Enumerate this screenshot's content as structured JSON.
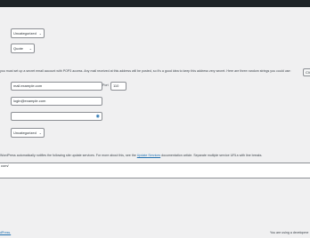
{
  "selects": {
    "category_top": "Uncategorized",
    "format": "Quote",
    "category_bottom": "Uncategorized"
  },
  "mail": {
    "description": "you must set up a secret email account with POP3 access. Any mail received at this address will be posted, so it's a good idea to keep this address very secret. Here are three random strings you could use:",
    "button_label": "Cli",
    "server_value": "mail.example.com",
    "port_label": "Port",
    "port_value": "110",
    "login_value": "login@example.com",
    "password_value": ""
  },
  "update_services": {
    "description_pre": "WordPress automatically notifies the following site update services. For more about this, see the",
    "link_text": "Update Services",
    "description_post": "documentation article. Separate multiple service URLs with line breaks.",
    "textarea_value": "com/"
  },
  "footer": {
    "left_link": "dPress.",
    "right_text": "You are using a developme"
  }
}
